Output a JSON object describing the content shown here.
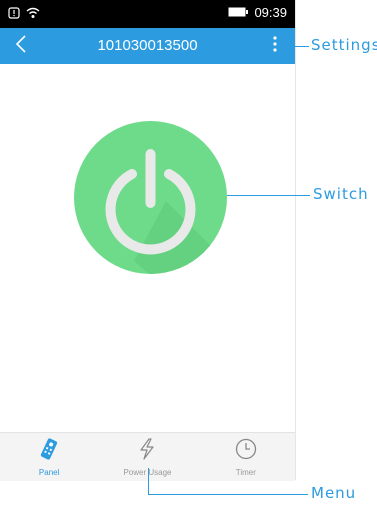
{
  "status_bar": {
    "time": "09:39"
  },
  "app_bar": {
    "title": "101030013500"
  },
  "tabs": [
    {
      "label": "Panel",
      "active": true
    },
    {
      "label": "Power Usage",
      "active": false
    },
    {
      "label": "Timer",
      "active": false
    }
  ],
  "callouts": {
    "settings": "Settings",
    "switch": "Switch",
    "menu": "Menu"
  },
  "colors": {
    "accent": "#2c9be0",
    "power_green": "#6ddb8a",
    "status_bar": "#000000"
  }
}
